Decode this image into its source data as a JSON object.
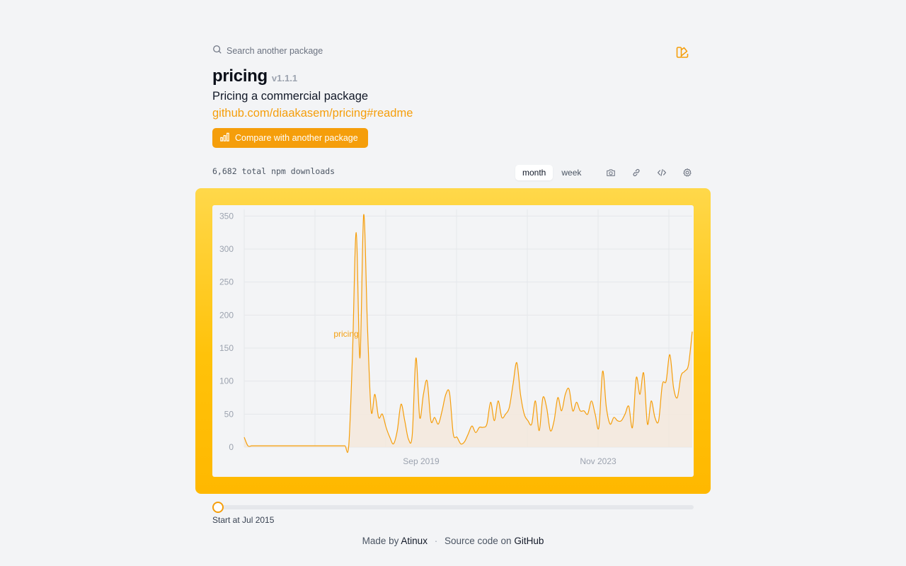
{
  "search": {
    "placeholder": "Search another package"
  },
  "package": {
    "name": "pricing",
    "version": "v1.1.1",
    "description": "Pricing a commercial package",
    "link": "github.com/diaakasem/pricing#readme"
  },
  "compare_label": "Compare with another package",
  "total_downloads": "6,682 total npm downloads",
  "period": {
    "month_label": "month",
    "week_label": "week",
    "active": "month"
  },
  "tools": [
    "camera-icon",
    "link-icon",
    "code-icon",
    "gear-icon"
  ],
  "colors": {
    "accent": "#f59e0b",
    "fill": "#f3e8dc",
    "frame_top": "#ffd84a",
    "frame_bottom": "#ffb800"
  },
  "range": {
    "start_label": "Start at Jul 2015",
    "start_fraction": 0
  },
  "footer": {
    "made_by": "Made by",
    "author": "Atinux",
    "source_prefix": "Source code on",
    "source_link": "GitHub"
  },
  "chart_data": {
    "type": "area",
    "series": [
      {
        "name": "pricing",
        "values": [
          15,
          2,
          2,
          2,
          2,
          2,
          2,
          2,
          2,
          2,
          2,
          2,
          2,
          2,
          2,
          2,
          2,
          2,
          2,
          2,
          2,
          2,
          2,
          2,
          2,
          2,
          2,
          2,
          2,
          140,
          325,
          135,
          352,
          185,
          55,
          80,
          45,
          50,
          30,
          15,
          5,
          25,
          65,
          40,
          12,
          18,
          135,
          45,
          80,
          100,
          40,
          45,
          35,
          55,
          80,
          82,
          20,
          15,
          5,
          8,
          20,
          32,
          22,
          30,
          30,
          35,
          68,
          40,
          70,
          45,
          50,
          60,
          95,
          128,
          80,
          50,
          40,
          35,
          70,
          25,
          75,
          60,
          25,
          40,
          75,
          55,
          80,
          88,
          55,
          68,
          55,
          55,
          50,
          70,
          50,
          30,
          115,
          60,
          35,
          45,
          40,
          40,
          50,
          62,
          30,
          105,
          80,
          112,
          35,
          70,
          45,
          40,
          95,
          100,
          140,
          90,
          75,
          108,
          115,
          125,
          175
        ]
      }
    ],
    "x_range": [
      "Jul 2015",
      "Mar 2026"
    ],
    "x_ticks": [
      "Sep 2019",
      "Nov 2023"
    ],
    "y_ticks": [
      0,
      50,
      100,
      150,
      200,
      250,
      300,
      350
    ],
    "ylim": [
      0,
      360
    ],
    "grid": true,
    "series_label": "pricing"
  }
}
